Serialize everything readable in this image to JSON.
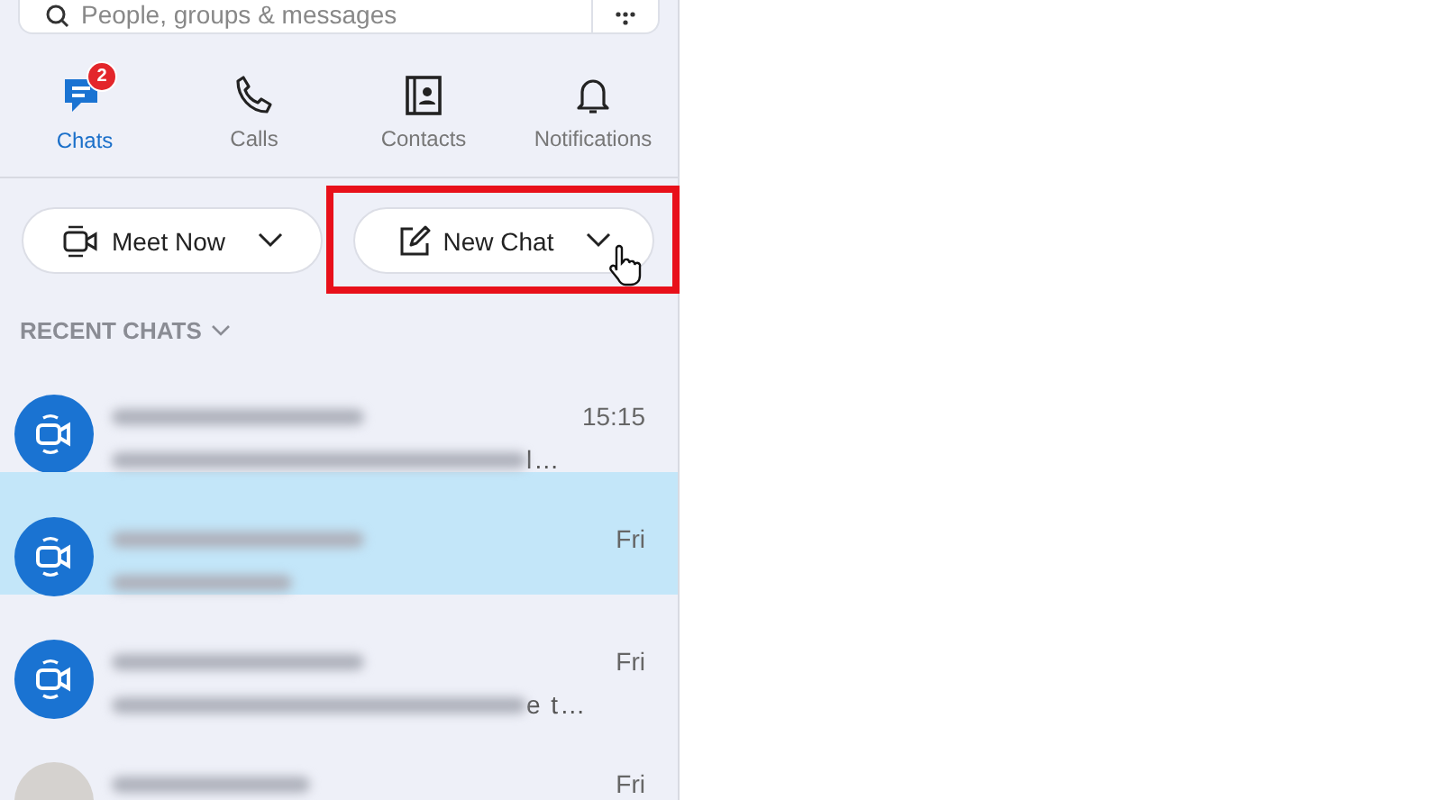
{
  "search": {
    "placeholder": "People, groups & messages"
  },
  "tabs": [
    {
      "label": "Chats",
      "kind": "chats",
      "selected": true,
      "badge": "2"
    },
    {
      "label": "Calls",
      "kind": "calls",
      "selected": false
    },
    {
      "label": "Contacts",
      "kind": "contacts",
      "selected": false
    },
    {
      "label": "Notifications",
      "kind": "bell",
      "selected": false
    }
  ],
  "actions": [
    {
      "label": "Meet Now",
      "kind": "meet"
    },
    {
      "label": "New Chat",
      "kind": "compose",
      "highlighted": true
    }
  ],
  "recent": {
    "title": "RECENT CHATS"
  },
  "chats": [
    {
      "kind": "meeting",
      "time": "15:15",
      "preview_tail": "l…",
      "selected": false
    },
    {
      "kind": "meeting",
      "time": "Fri",
      "selected": true
    },
    {
      "kind": "meeting",
      "time": "Fri",
      "preview_tail": "e t…",
      "selected": false
    },
    {
      "kind": "person",
      "time": "Fri",
      "selected": false
    }
  ]
}
